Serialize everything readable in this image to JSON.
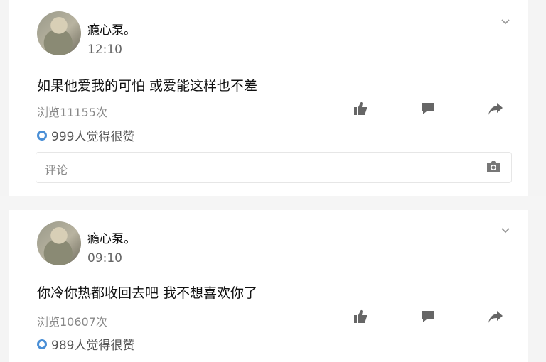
{
  "posts": [
    {
      "author": "瘾心泵。",
      "time": "12:10",
      "content": "如果他爱我的可怕 或爱能这样也不差",
      "views": "浏览11155次",
      "likes": "999人觉得很赞",
      "comment_placeholder": "评论"
    },
    {
      "author": "瘾心泵。",
      "time": "09:10",
      "content": "你冷你热都收回去吧 我不想喜欢你了",
      "views": "浏览10607次",
      "likes": "989人觉得很赞",
      "comment_placeholder": ""
    }
  ],
  "icons": {
    "like": "thumbs-up-icon",
    "comment": "comment-icon",
    "share": "share-icon",
    "camera": "camera-icon",
    "more": "chevron-down-icon",
    "likes": "like-ring-icon"
  },
  "colors": {
    "accent": "#4a8fd6",
    "muted": "#888888",
    "icon": "#666666"
  }
}
